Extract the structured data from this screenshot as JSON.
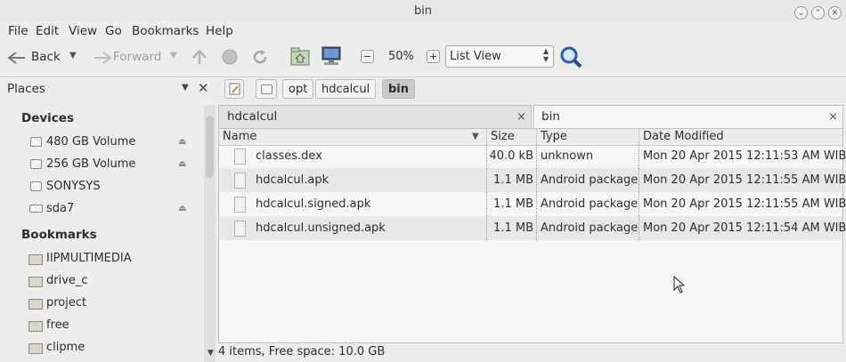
{
  "window": {
    "title": "bin"
  },
  "menu": [
    "File",
    "Edit",
    "View",
    "Go",
    "Bookmarks",
    "Help"
  ],
  "toolbar": {
    "back_label": "Back",
    "forward_label": "Forward",
    "zoom": "50%",
    "view_mode": "List View"
  },
  "sidebar": {
    "title": "Places",
    "devices_heading": "Devices",
    "devices": [
      "480 GB Volume",
      "256 GB Volume",
      "SONYSYS",
      "sda7"
    ],
    "bookmarks_heading": "Bookmarks",
    "bookmarks": [
      "IIPMULTIMEDIA",
      "drive_c",
      "project",
      "free",
      "clipme"
    ]
  },
  "pathbar": [
    "opt",
    "hdcalcul",
    "bin"
  ],
  "tabs": [
    {
      "label": "hdcalcul",
      "close": "×"
    },
    {
      "label": "bin",
      "close": "×"
    }
  ],
  "columns": {
    "name": "Name",
    "size": "Size",
    "type": "Type",
    "date": "Date Modified"
  },
  "files": [
    {
      "name": "classes.dex",
      "size": "40.0 kB",
      "type": "unknown",
      "date": "Mon 20 Apr 2015 12:11:53 AM WIB"
    },
    {
      "name": "hdcalcul.apk",
      "size": "1.1 MB",
      "type": "Android package",
      "date": "Mon 20 Apr 2015 12:11:55 AM WIB"
    },
    {
      "name": "hdcalcul.signed.apk",
      "size": "1.1 MB",
      "type": "Android package",
      "date": "Mon 20 Apr 2015 12:11:55 AM WIB"
    },
    {
      "name": "hdcalcul.unsigned.apk",
      "size": "1.1 MB",
      "type": "Android package",
      "date": "Mon 20 Apr 2015 12:11:54 AM WIB"
    }
  ],
  "status": "4 items, Free space: 10.0 GB",
  "colors": {
    "window_bg": "#ededeb",
    "active_crumb": "#c9c9c7",
    "search_icon": "#2a5db0"
  }
}
